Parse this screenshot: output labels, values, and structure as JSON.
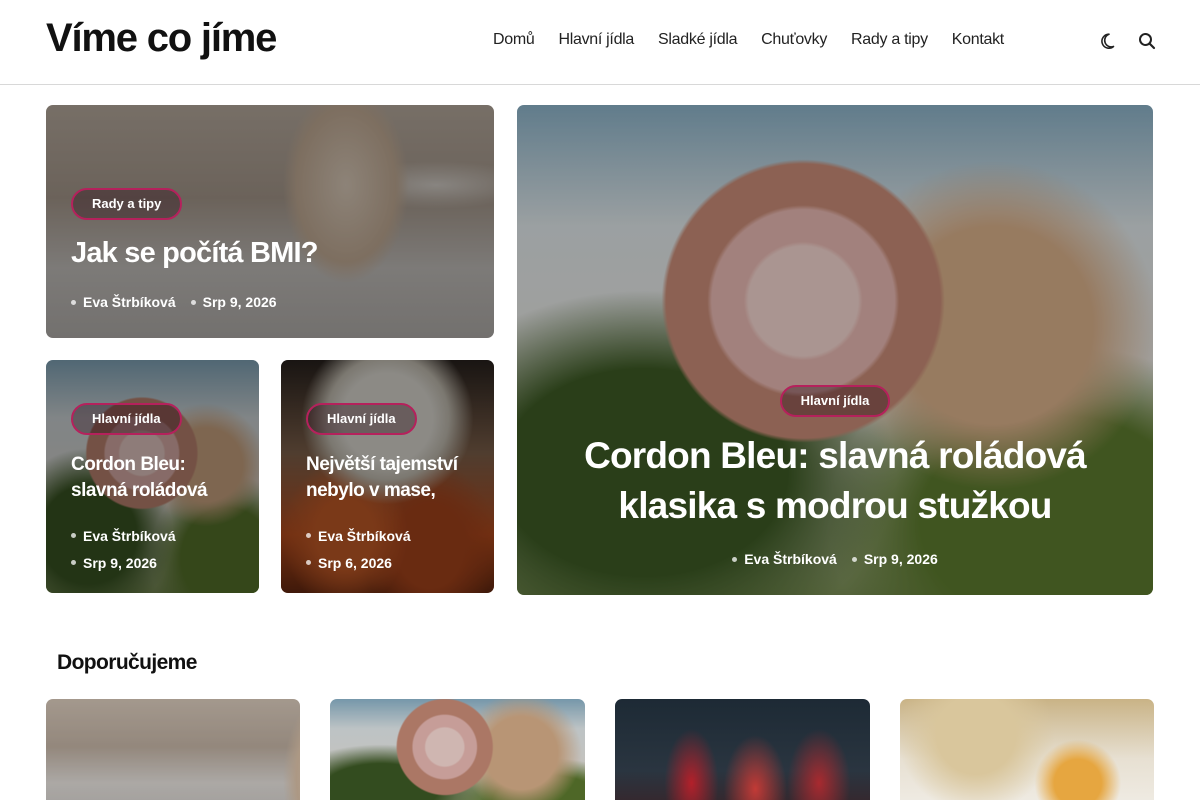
{
  "site": {
    "logo": "Víme co jíme"
  },
  "nav": {
    "items": [
      {
        "label": "Domů"
      },
      {
        "label": "Hlavní jídla"
      },
      {
        "label": "Sladké jídla"
      },
      {
        "label": "Chuťovky"
      },
      {
        "label": "Rady a tipy"
      },
      {
        "label": "Kontakt"
      }
    ]
  },
  "header_icons": {
    "theme": "moon-icon",
    "search": "search-icon"
  },
  "featured": {
    "top_left": {
      "category": "Rady a tipy",
      "title": "Jak se počítá BMI?",
      "author": "Eva Štrbíková",
      "date": "Srp 9, 2026"
    },
    "small_1": {
      "category": "Hlavní jídla",
      "title_line1": "Cordon Bleu:",
      "title_line2": "slavná roládová",
      "author": "Eva Štrbíková",
      "date": "Srp 9, 2026"
    },
    "small_2": {
      "category": "Hlavní jídla",
      "title_line1": "Největší tajemství",
      "title_line2": "nebylo v mase,",
      "author": "Eva Štrbíková",
      "date": "Srp 6, 2026"
    },
    "big": {
      "category": "Hlavní jídla",
      "title_line1": "Cordon Bleu: slavná roládová",
      "title_line2": "klasika s modrou stužkou",
      "author": "Eva Štrbíková",
      "date": "Srp 9, 2026"
    }
  },
  "recommended": {
    "title": "Doporučujeme"
  },
  "colors": {
    "badge_border": "#b5215c",
    "overlay": "rgba(0,0,0,0.42)"
  }
}
